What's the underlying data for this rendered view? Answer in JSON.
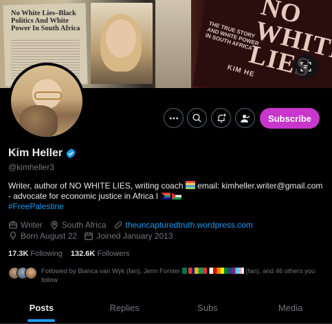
{
  "profile": {
    "name": "Kim Heller",
    "handle": "@kimheller3",
    "verified": true,
    "bio_part1": "Writer, author of NO WHITE LIES, writing coach ",
    "bio_part2": " email: kimheller.writer@gmail.com - advocate for economic justice in Africa I ",
    "bio_hashtag": "#FreePalestine"
  },
  "banner": {
    "headline": "No White Lies–Black Politics And White Power In South Africa",
    "book_title": "NO WHITE LIES",
    "book_subtitle": "THE TRUE STORY AND WHITE POWER IN SOUTH AFRICA",
    "book_author": "KIM HE"
  },
  "actions": {
    "more_icon": "more-icon",
    "search_icon": "search-icon",
    "notify_icon": "bell-plus-icon",
    "follow_icon": "person-check-icon",
    "subscribe_label": "Subscribe"
  },
  "meta": {
    "profession": "Writer",
    "location": "South Africa",
    "website": "theuncapturedtruth.wordpress.com",
    "birthday": "Born August 22",
    "joined": "Joined January 2013"
  },
  "stats": {
    "following_count": "17.3K",
    "following_label": "Following",
    "followers_count": "132.6K",
    "followers_label": "Followers"
  },
  "followed_by": {
    "text_prefix": "Followed by Bianca van Wyk (fan), Jenn Forster ",
    "text_suffix": " (fan), and 46 others you follow"
  },
  "tabs": [
    {
      "label": "Posts",
      "active": true
    },
    {
      "label": "Replies",
      "active": false
    },
    {
      "label": "Subs",
      "active": false
    },
    {
      "label": "Media",
      "active": false
    }
  ],
  "colors": {
    "accent": "#1d9bf0",
    "subscribe": "#c936cc",
    "background": "#000000",
    "muted": "#71767b"
  }
}
